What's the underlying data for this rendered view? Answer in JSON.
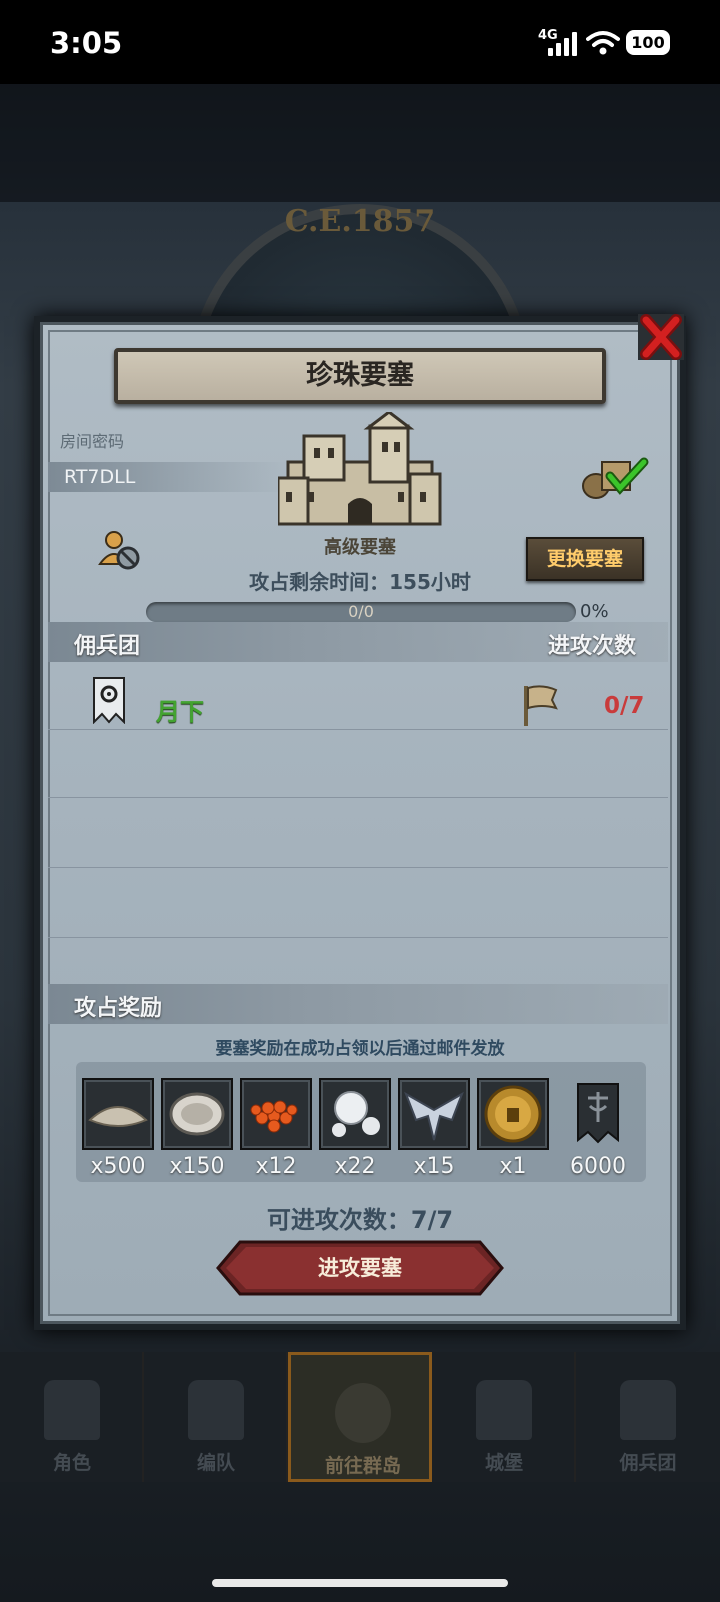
{
  "status": {
    "time": "3:05",
    "network": "4G",
    "battery": "100"
  },
  "background": {
    "era_text": "C.E.1857"
  },
  "dialog": {
    "title": "珍珠要塞",
    "room_code_label": "房间密码",
    "room_code": "RT7DLL",
    "fort_level": "高级要塞",
    "swap_button": "更换要塞",
    "remaining_time": "攻占剩余时间：155小时",
    "progress_text": "0/0",
    "progress_percent": "0%",
    "progress_fraction": 0,
    "guild_header": "佣兵团",
    "attack_count_header": "进攻次数",
    "guild_rows": [
      {
        "name": "月下",
        "attacks": "0/7"
      }
    ],
    "rewards_header": "攻占奖励",
    "rewards_note": "要塞奖励在成功占领以后通过邮件发放",
    "rewards": [
      {
        "icon": "salt-icon",
        "qty": "x500"
      },
      {
        "icon": "oyster-icon",
        "qty": "x150"
      },
      {
        "icon": "caviar-icon",
        "qty": "x12"
      },
      {
        "icon": "pearl-icon",
        "qty": "x22"
      },
      {
        "icon": "silver-emblem-icon",
        "qty": "x15"
      },
      {
        "icon": "gold-helmet-coin-icon",
        "qty": "x1"
      },
      {
        "icon": "guild-banner-icon",
        "qty": "6000"
      }
    ],
    "available_attacks": "可进攻次数：7/7",
    "attack_button": "进攻要塞"
  },
  "nav": {
    "items": [
      {
        "label": "角色",
        "icon": "knight-icon"
      },
      {
        "label": "编队",
        "icon": "formation-icon"
      },
      {
        "label": "前往群岛",
        "icon": "islands-compass-icon"
      },
      {
        "label": "城堡",
        "icon": "castle-icon"
      },
      {
        "label": "佣兵团",
        "icon": "ship-icon"
      }
    ]
  },
  "colors": {
    "guild_name": "#43a331",
    "attack_count": "#c93b3b",
    "swap_button_text": "#ffcc6b",
    "dialog_bg": "#a7b4be"
  }
}
